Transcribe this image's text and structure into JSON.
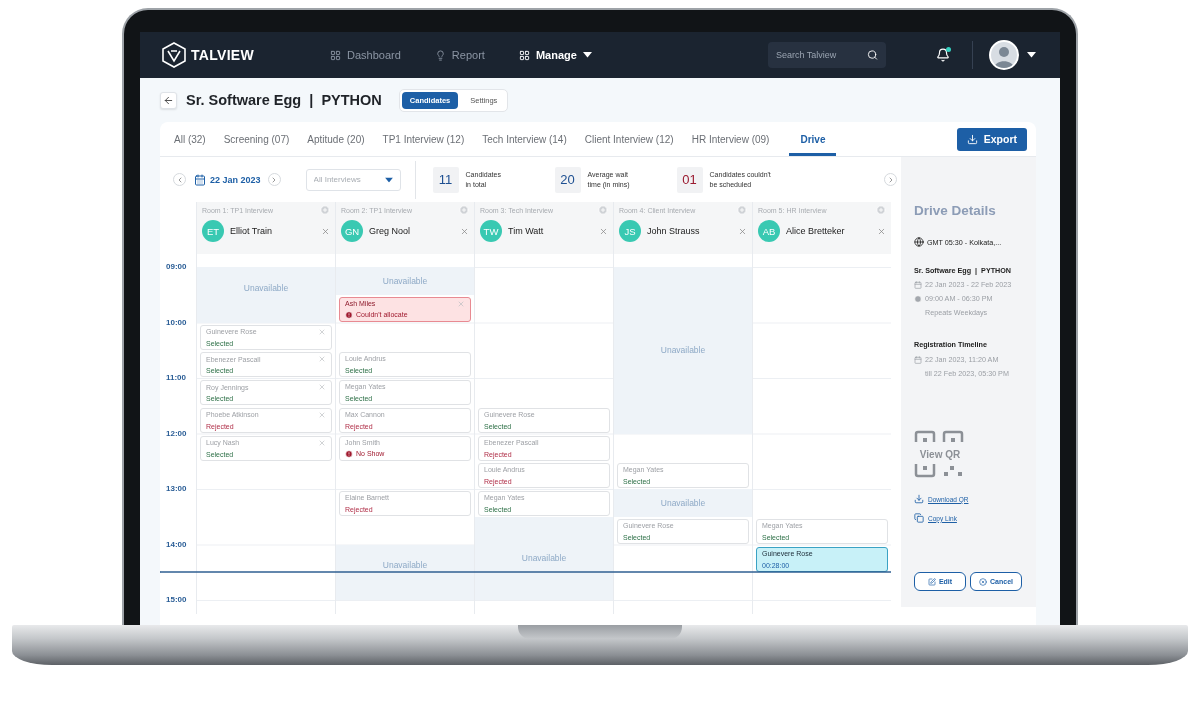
{
  "nav": {
    "logo": "TALVIEW",
    "items": [
      {
        "label": "Dashboard",
        "selected": false,
        "dropdown": false
      },
      {
        "label": "Report",
        "selected": false,
        "dropdown": false
      },
      {
        "label": "Manage",
        "selected": true,
        "dropdown": true
      }
    ],
    "search": {
      "placeholder": "Search Talview"
    },
    "notifications_unread": true
  },
  "header": {
    "title": "Sr. Software Egg  |  PYTHON",
    "segments": [
      {
        "label": "Candidates",
        "selected": true
      },
      {
        "label": "Settings",
        "selected": false
      }
    ]
  },
  "tabs": [
    {
      "label": "All (32)",
      "selected": false
    },
    {
      "label": "Screening (07)",
      "selected": false
    },
    {
      "label": "Aptitude (20)",
      "selected": false
    },
    {
      "label": "TP1 Interview (12)",
      "selected": false
    },
    {
      "label": "Tech Interview (14)",
      "selected": false
    },
    {
      "label": "Client Interview (12)",
      "selected": false
    },
    {
      "label": "HR Interview (09)",
      "selected": false
    },
    {
      "label": "Drive",
      "selected": true
    }
  ],
  "export_button": "Export",
  "toolbar": {
    "date": "22 Jan 2023",
    "filter": {
      "placeholder": "All Interviews"
    },
    "stats": [
      {
        "value": "11",
        "lines": [
          "Candidates",
          "in total"
        ],
        "kind": "normal"
      },
      {
        "value": "20",
        "lines": [
          "Average wait",
          "time (in mins)"
        ],
        "kind": "normal"
      },
      {
        "value": "01",
        "lines": [
          "Candidates couldn't",
          "be scheduled"
        ],
        "kind": "alert"
      }
    ]
  },
  "time_slots": [
    {
      "label": "09:00",
      "now": false
    },
    {
      "now": false
    },
    {
      "label": "10:00",
      "now": false
    },
    {
      "now": false
    },
    {
      "label": "11:00",
      "now": false
    },
    {
      "now": false
    },
    {
      "label": "12:00",
      "now": false
    },
    {
      "now": false
    },
    {
      "label": "13:00",
      "now": false
    },
    {
      "now": false
    },
    {
      "label": "14:00",
      "now": false
    },
    {
      "now": true
    },
    {
      "label": "15:00",
      "now": false
    }
  ],
  "rooms": [
    {
      "label": "Room 1: TP1 Interview",
      "interviewer": {
        "initials": "ET",
        "name": "Elliot Train"
      },
      "slots": [
        {
          "kind": "unavailable",
          "label": "Unavailable"
        },
        {
          "kind": "unavailable"
        },
        {
          "kind": "candidate",
          "name": "Guinevere Rose",
          "status": {
            "text": "Selected",
            "kind": "selected"
          },
          "closable": true
        },
        {
          "kind": "candidate",
          "name": "Ebenezer Pascall",
          "status": {
            "text": "Selected",
            "kind": "selected"
          },
          "closable": true
        },
        {
          "kind": "candidate",
          "name": "Roy Jennings",
          "status": {
            "text": "Selected",
            "kind": "selected"
          },
          "closable": true
        },
        {
          "kind": "candidate",
          "name": "Phoebe Atkinson",
          "status": {
            "text": "Rejected",
            "kind": "rejected"
          },
          "closable": true
        },
        {
          "kind": "candidate",
          "name": "Lucy Nash",
          "status": {
            "text": "Selected",
            "kind": "selected"
          },
          "closable": true
        },
        {
          "kind": "empty"
        },
        {
          "kind": "empty"
        },
        {
          "kind": "empty"
        },
        {
          "kind": "empty"
        },
        {
          "kind": "empty"
        },
        {
          "kind": "empty"
        }
      ]
    },
    {
      "label": "Room 2: TP1 Interview",
      "interviewer": {
        "initials": "GN",
        "name": "Greg Nool"
      },
      "slots": [
        {
          "kind": "unavailable",
          "label": "Unavailable"
        },
        {
          "kind": "alert",
          "name": "Ash Miles",
          "status": {
            "text": "Couldn't allocate",
            "kind": "error"
          },
          "closable": true
        },
        {
          "kind": "empty"
        },
        {
          "kind": "candidate",
          "name": "Louie Andrus",
          "status": {
            "text": "Selected",
            "kind": "selected"
          },
          "closable": false
        },
        {
          "kind": "candidate",
          "name": "Megan Yates",
          "status": {
            "text": "Selected",
            "kind": "selected"
          },
          "closable": false
        },
        {
          "kind": "candidate",
          "name": "Max Cannon",
          "status": {
            "text": "Rejected",
            "kind": "rejected"
          },
          "closable": false
        },
        {
          "kind": "candidate",
          "name": "John Smith",
          "status": {
            "text": "No Show",
            "kind": "error"
          },
          "closable": false
        },
        {
          "kind": "empty"
        },
        {
          "kind": "candidate",
          "name": "Elaine Barnett",
          "status": {
            "text": "Rejected",
            "kind": "rejected"
          },
          "closable": false
        },
        {
          "kind": "empty"
        },
        {
          "kind": "unavailable",
          "label": "Unavailable"
        },
        {
          "kind": "unavailable"
        },
        {
          "kind": "empty"
        }
      ]
    },
    {
      "label": "Room 3: Tech Interview",
      "interviewer": {
        "initials": "TW",
        "name": "Tim Watt"
      },
      "slots": [
        {
          "kind": "empty"
        },
        {
          "kind": "empty"
        },
        {
          "kind": "empty"
        },
        {
          "kind": "empty"
        },
        {
          "kind": "empty"
        },
        {
          "kind": "candidate",
          "name": "Guinevere Rose",
          "status": {
            "text": "Selected",
            "kind": "selected"
          },
          "closable": false
        },
        {
          "kind": "candidate",
          "name": "Ebenezer Pascall",
          "status": {
            "text": "Rejected",
            "kind": "rejected"
          },
          "closable": false
        },
        {
          "kind": "candidate",
          "name": "Louie Andrus",
          "status": {
            "text": "Rejected",
            "kind": "rejected"
          },
          "closable": false
        },
        {
          "kind": "candidate",
          "name": "Megan Yates",
          "status": {
            "text": "Selected",
            "kind": "selected"
          },
          "closable": false
        },
        {
          "kind": "unavailable",
          "label": "Unavailable"
        },
        {
          "kind": "unavailable"
        },
        {
          "kind": "unavailable"
        },
        {
          "kind": "empty"
        }
      ]
    },
    {
      "label": "Room 4: Client Interview",
      "interviewer": {
        "initials": "JS",
        "name": "John Strauss"
      },
      "slots": [
        {
          "kind": "unavailable",
          "label": "Unavailable"
        },
        {
          "kind": "unavailable"
        },
        {
          "kind": "unavailable"
        },
        {
          "kind": "unavailable"
        },
        {
          "kind": "unavailable"
        },
        {
          "kind": "unavailable"
        },
        {
          "kind": "empty"
        },
        {
          "kind": "candidate",
          "name": "Megan Yates",
          "status": {
            "text": "Selected",
            "kind": "selected"
          },
          "closable": false
        },
        {
          "kind": "unavailable",
          "label": "Unavailable"
        },
        {
          "kind": "candidate",
          "name": "Guinevere Rose",
          "status": {
            "text": "Selected",
            "kind": "selected"
          },
          "closable": false
        },
        {
          "kind": "empty"
        },
        {
          "kind": "empty"
        },
        {
          "kind": "empty"
        }
      ]
    },
    {
      "label": "Room 5: HR Interview",
      "interviewer": {
        "initials": "AB",
        "name": "Alice Bretteker"
      },
      "slots": [
        {
          "kind": "empty"
        },
        {
          "kind": "empty"
        },
        {
          "kind": "empty"
        },
        {
          "kind": "empty"
        },
        {
          "kind": "empty"
        },
        {
          "kind": "empty"
        },
        {
          "kind": "empty"
        },
        {
          "kind": "empty"
        },
        {
          "kind": "empty"
        },
        {
          "kind": "candidate",
          "name": "Megan Yates",
          "status": {
            "text": "Selected",
            "kind": "selected"
          },
          "closable": false
        },
        {
          "kind": "active",
          "name": "Guinevere Rose",
          "status": {
            "text": "00:28:00",
            "kind": "timer"
          },
          "closable": false
        },
        {
          "kind": "empty"
        },
        {
          "kind": "empty"
        }
      ]
    }
  ],
  "drive_details": {
    "title": "Drive Details",
    "timezone": "GMT 05:30 - Kolkata,...",
    "drive_name": "Sr. Software Egg  |  PYTHON",
    "date_range": "22 Jan 2023 - 22 Feb 2023",
    "time_range": "09:00 AM - 06:30 PM",
    "repeat": "Repeats Weekdays",
    "registration": {
      "title": "Registration Timeline",
      "from": "22 Jan 2023, 11:20 AM",
      "till": "till 22 Feb 2023, 05:30 PM"
    },
    "qr_label": "View QR",
    "links": [
      {
        "kind": "download",
        "label": "Download QR"
      },
      {
        "kind": "copy",
        "label": "Copy Link"
      }
    ],
    "buttons": [
      {
        "kind": "edit",
        "label": "Edit"
      },
      {
        "kind": "cancel",
        "label": "Cancel"
      }
    ]
  }
}
